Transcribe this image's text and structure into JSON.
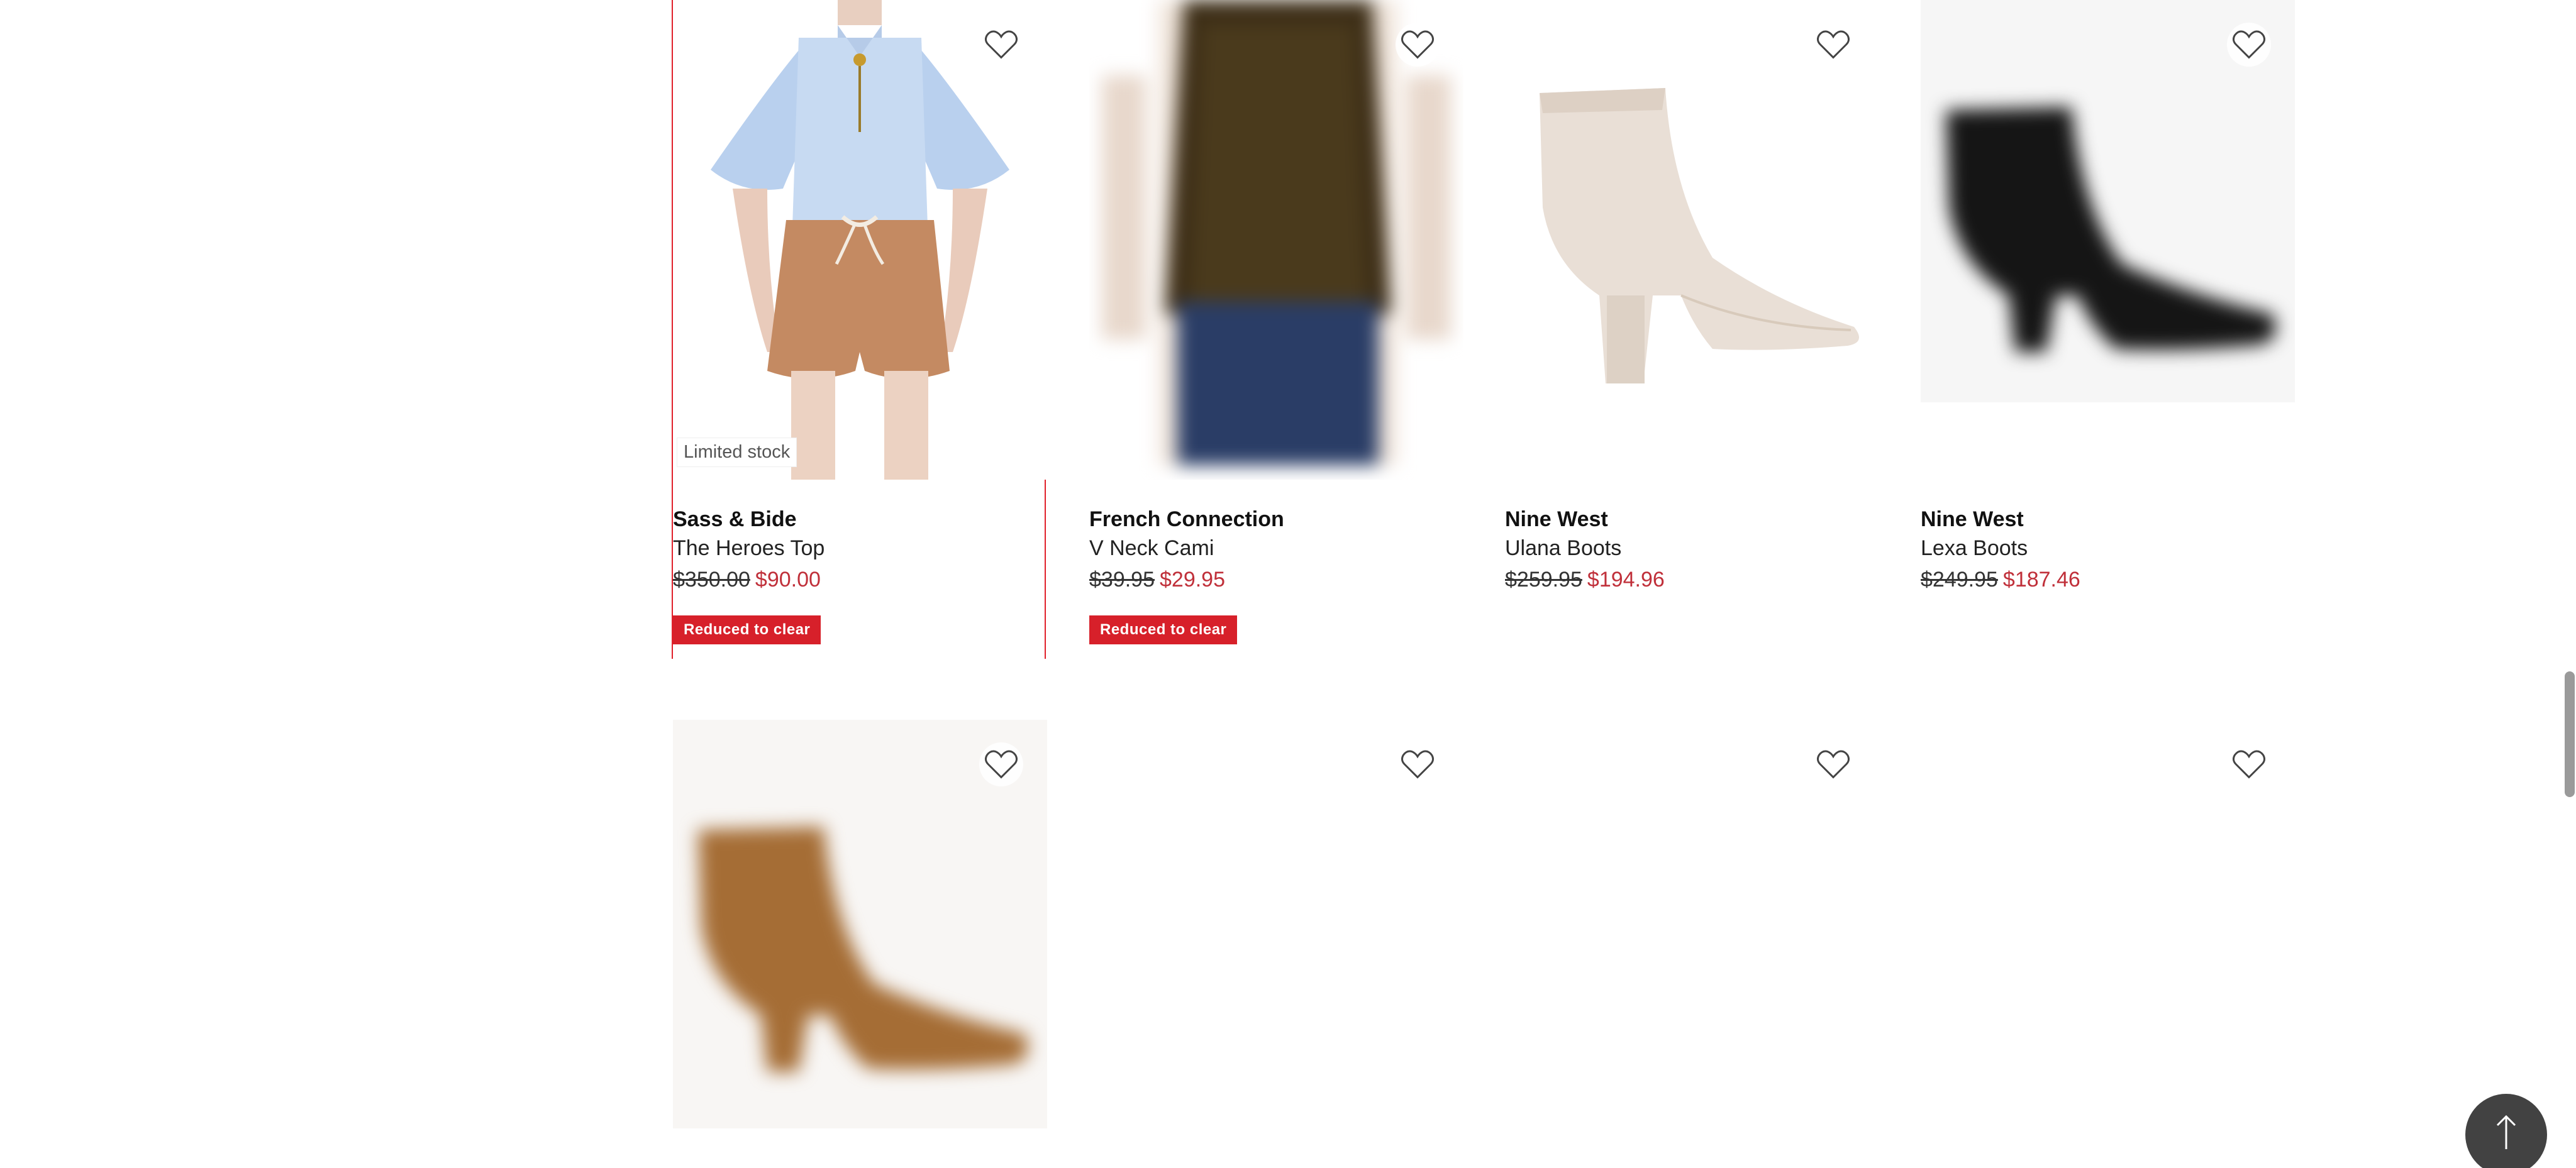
{
  "products": [
    {
      "brand": "Sass & Bide",
      "name": "The Heroes Top",
      "original_price": "$350.00",
      "sale_price": "$90.00",
      "limited_label": "Limited stock",
      "badge": "Reduced to clear",
      "image": "blouse-shorts"
    },
    {
      "brand": "French Connection",
      "name": "V Neck Cami",
      "original_price": "$39.95",
      "sale_price": "$29.95",
      "badge": "Reduced to clear",
      "image": "cami"
    },
    {
      "brand": "Nine West",
      "name": "Ulana Boots",
      "original_price": "$259.95",
      "sale_price": "$194.96",
      "image": "beige-boot"
    },
    {
      "brand": "Nine West",
      "name": "Lexa Boots",
      "original_price": "$249.95",
      "sale_price": "$187.46",
      "image": "black-boot"
    }
  ],
  "second_row": [
    {
      "image": "tan-boot"
    },
    {
      "image": "loading"
    },
    {
      "image": "loading"
    },
    {
      "image": "loading"
    }
  ],
  "icons": {
    "wishlist": "heart-outline-icon",
    "back_to_top": "arrow-up-icon"
  },
  "colors": {
    "accent_red": "#d7202a",
    "sale_red": "#c0303a"
  }
}
